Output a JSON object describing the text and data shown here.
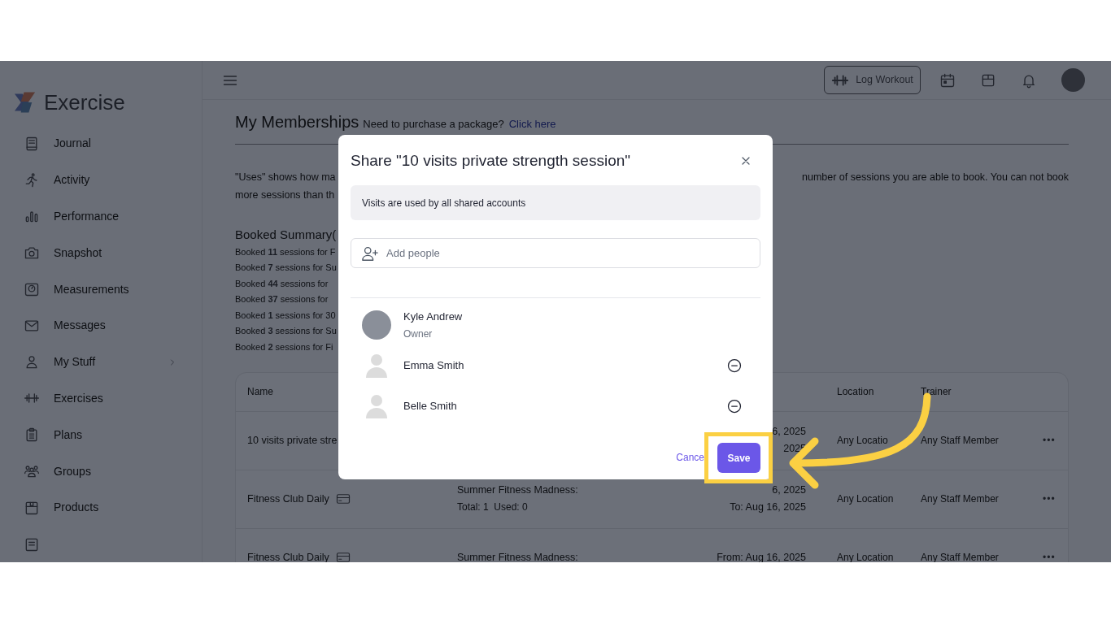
{
  "sidebar": {
    "logo_text": "Exercise",
    "items": [
      {
        "label": "Journal",
        "expandable": false
      },
      {
        "label": "Activity",
        "expandable": false
      },
      {
        "label": "Performance",
        "expandable": false
      },
      {
        "label": "Snapshot",
        "expandable": false
      },
      {
        "label": "Measurements",
        "expandable": false
      },
      {
        "label": "Messages",
        "expandable": false
      },
      {
        "label": "My Stuff",
        "expandable": true
      },
      {
        "label": "Exercises",
        "expandable": false
      },
      {
        "label": "Plans",
        "expandable": false
      },
      {
        "label": "Groups",
        "expandable": false
      },
      {
        "label": "Products",
        "expandable": false
      }
    ]
  },
  "header": {
    "log_button": "Log Workout"
  },
  "page": {
    "title": "My Memberships",
    "purchase_prompt": "Need to purchase a package?",
    "purchase_link": "Click here",
    "note_left": [
      "\"Uses\" shows how ma",
      "more sessions than th"
    ],
    "note_right": "number of sessions you are able to book. You can not book",
    "summary_title": "Booked Summary(",
    "summary_lines": [
      "Booked **11** sessions for F",
      "Booked **7** sessions for Su",
      "Booked **44** sessions for",
      "Booked **37** sessions for",
      "Booked **1** sessions for 30",
      "Booked **3** sessions for Su",
      "Booked **2** sessions for Fi"
    ]
  },
  "table": {
    "columns": [
      "Name",
      "Location",
      "Trainer"
    ],
    "rows": [
      {
        "name": "10 visits private stre",
        "card_icon": false,
        "dates": [
          "6, 2025",
          "2025"
        ],
        "location": "Any Locatio",
        "trainer": "Any Staff Member",
        "menu": "•••"
      },
      {
        "name": "Fitness Club Daily",
        "card_icon": true,
        "plan": [
          "Summer Fitness Madness:",
          "Total: 1  Used: 0"
        ],
        "dates": [
          "6, 2025",
          "To: Aug 16, 2025"
        ],
        "location": "Any Location",
        "trainer": "Any Staff Member",
        "menu": "•••"
      },
      {
        "name": "Fitness Club Daily",
        "card_icon": true,
        "plan": [
          "Summer Fitness Madness:"
        ],
        "dates": [
          "From: Aug 16, 2025"
        ],
        "location": "Any Location",
        "trainer": "Any Staff Member",
        "menu": "•••"
      }
    ]
  },
  "modal": {
    "title": "Share \"10 visits private strength session\"",
    "info": "Visits are used by all shared accounts",
    "add_placeholder": "Add people",
    "people": [
      {
        "name": "Kyle Andrew",
        "role": "Owner",
        "kind": "owner"
      },
      {
        "name": "Emma Smith",
        "kind": "member"
      },
      {
        "name": "Belle Smith",
        "kind": "member"
      }
    ],
    "cancel": "Cance",
    "save": "Save"
  }
}
